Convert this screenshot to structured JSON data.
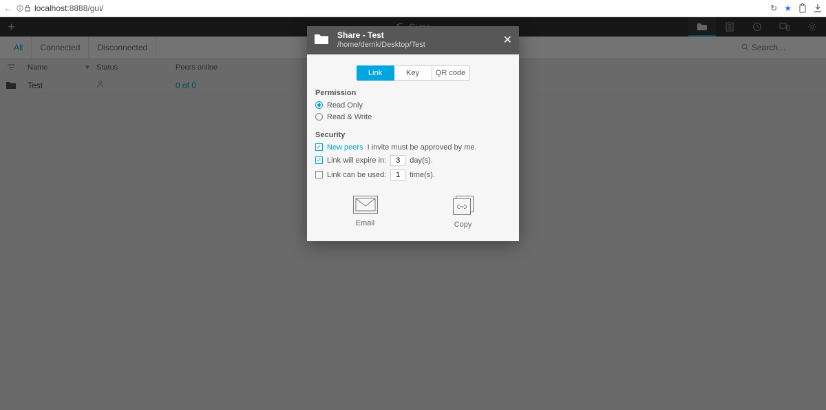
{
  "browser": {
    "url_host": "localhost",
    "url_rest": ":8888/gui/"
  },
  "app": {
    "title": "Sync",
    "toolbar_icons": [
      "folder",
      "document",
      "history",
      "devices",
      "settings"
    ]
  },
  "subbar": {
    "tabs": {
      "all": "All",
      "connected": "Connected",
      "disconnected": "Disconnected"
    },
    "search_placeholder": "Search…"
  },
  "table": {
    "headers": {
      "name": "Name",
      "status": "Status",
      "peers": "Peers online"
    },
    "rows": [
      {
        "name": "Test",
        "status_icon": "user",
        "peers": "0 of 0"
      }
    ]
  },
  "modal": {
    "title": "Share - Test",
    "subtitle": "/home/derrik/Desktop/Test",
    "tabs": {
      "link": "Link",
      "key": "Key",
      "qr": "QR code"
    },
    "permission": {
      "label": "Permission",
      "read_only": "Read Only",
      "read_write": "Read & Write"
    },
    "security": {
      "label": "Security",
      "new_peers_label": "New peers",
      "new_peers_rest": " I invite must be approved by me.",
      "expire_pre": "Link will expire in:",
      "expire_value": "3",
      "expire_post": "day(s).",
      "uses_pre": "Link can be used:",
      "uses_value": "1",
      "uses_post": "time(s)."
    },
    "actions": {
      "email": "Email",
      "copy": "Copy"
    }
  }
}
